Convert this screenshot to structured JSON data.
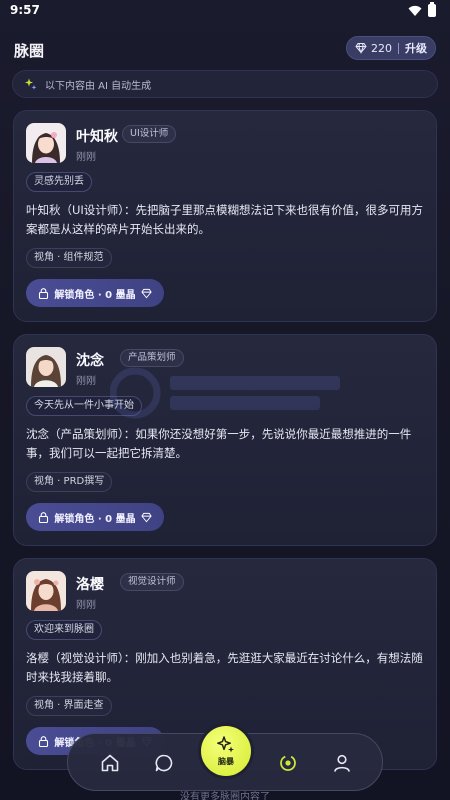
{
  "status_bar": {
    "time": "9:57"
  },
  "header": {
    "title": "脉圈",
    "points": "220",
    "upgrade_label": "升级"
  },
  "banner": {
    "text": "以下内容由 AI 自动生成"
  },
  "cards": [
    {
      "name": "叶知秋",
      "role": "UI设计师",
      "time": "刚刚",
      "tag": "灵感先别丢",
      "message": "叶知秋（UI设计师）：先把脑子里那点模糊想法记下来也很有价值，很多可用方案都是从这样的碎片开始长出来的。",
      "view": "视角 · 组件规范",
      "unlock_label": "解锁角色 · 0 墨晶"
    },
    {
      "name": "沈念",
      "role": "产品策划师",
      "time": "刚刚",
      "tag": "今天先从一件小事开始",
      "message": "沈念（产品策划师）：如果你还没想好第一步，先说说你最近最想推进的一件事，我们可以一起把它拆清楚。",
      "view": "视角 · PRD撰写",
      "unlock_label": "解锁角色 · 0 墨晶"
    },
    {
      "name": "洛樱",
      "role": "视觉设计师",
      "time": "刚刚",
      "tag": "欢迎来到脉圈",
      "message": "洛樱（视觉设计师）：刚加入也别着急，先逛逛大家最近在讨论什么，有想法随时来找我接着聊。",
      "view": "视角 · 界面走查",
      "unlock_label": "解锁角色 · 0 墨晶"
    }
  ],
  "footer": {
    "end_text": "没有更多脉圈内容了"
  },
  "nav": {
    "fab_label": "脑暴"
  },
  "colors": {
    "accent": "#d8ef33",
    "button": "#4a4d94",
    "background": "#161727"
  },
  "icons": [
    "wifi-icon",
    "battery-icon",
    "diamond-icon",
    "sparkle-icon",
    "lock-icon",
    "home-icon",
    "chat-icon",
    "brainstorm-icon",
    "orbit-icon",
    "profile-icon"
  ]
}
